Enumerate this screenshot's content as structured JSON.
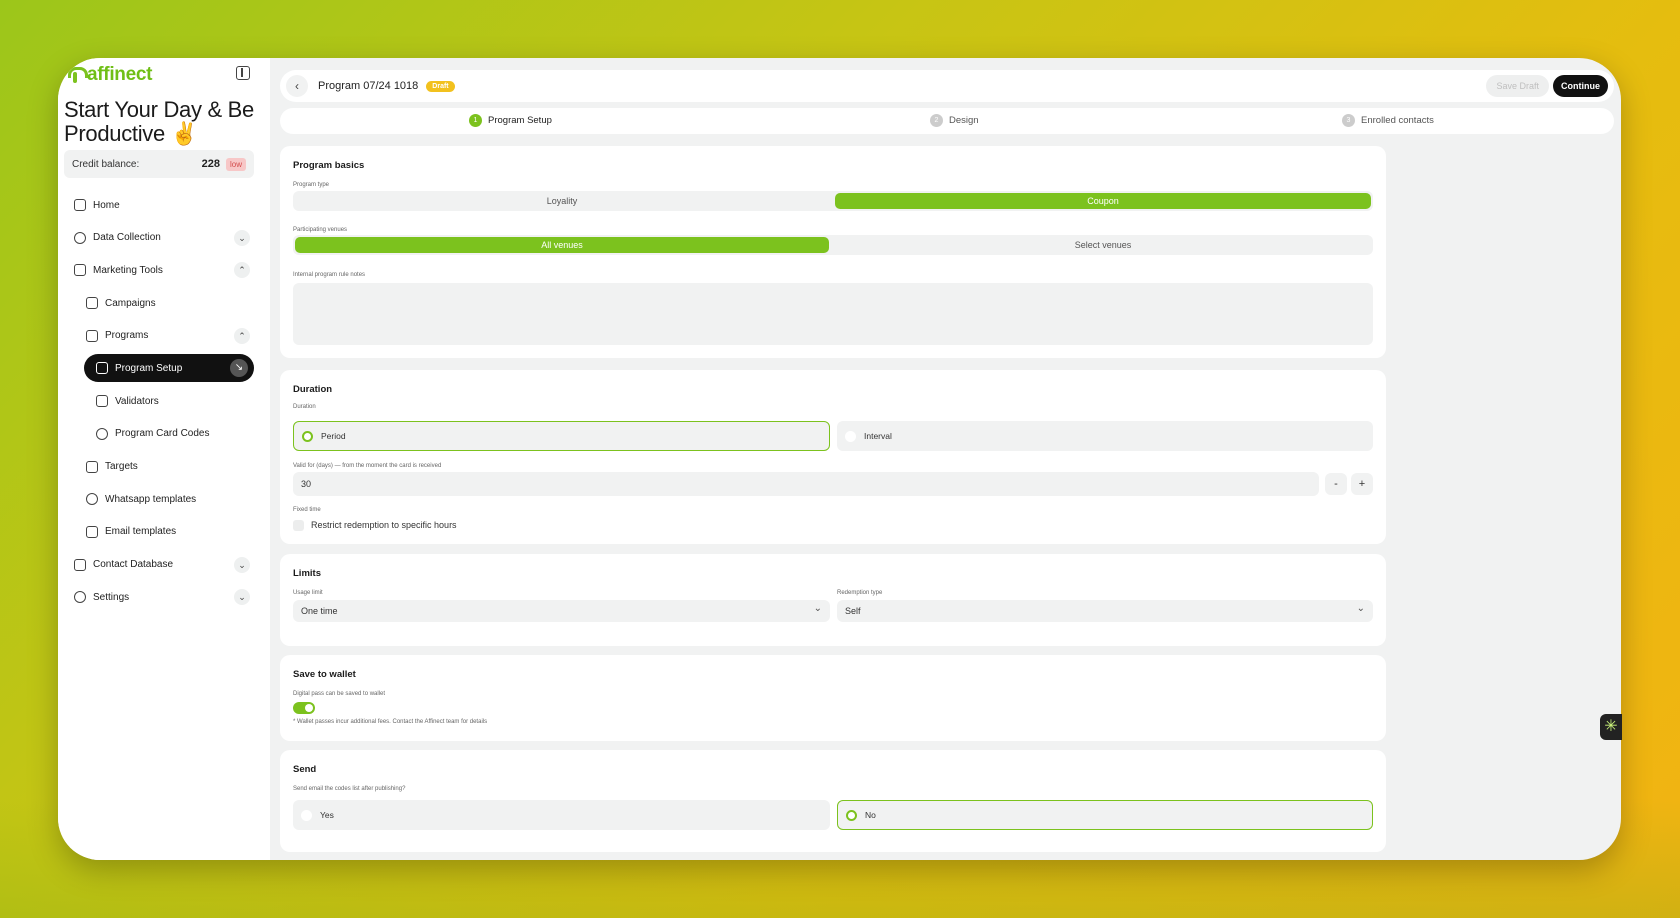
{
  "app": {
    "logo_text": "affinect"
  },
  "sidebar": {
    "greeting": "Start Your Day & Be Productive ✌️",
    "credit_label": "Credit balance:",
    "credit_value": "228",
    "credit_badge": "low",
    "items": [
      {
        "label": "Home"
      },
      {
        "label": "Data Collection"
      },
      {
        "label": "Marketing Tools"
      },
      {
        "label": "Campaigns"
      },
      {
        "label": "Programs"
      },
      {
        "label": "Program Setup"
      },
      {
        "label": "Validators"
      },
      {
        "label": "Program Card Codes"
      },
      {
        "label": "Targets"
      },
      {
        "label": "Whatsapp templates"
      },
      {
        "label": "Email templates"
      },
      {
        "label": "Contact Database"
      },
      {
        "label": "Settings"
      }
    ]
  },
  "header": {
    "back_icon": "‹",
    "title": "Program 07/24 1018",
    "status_badge": "Draft",
    "save_draft": "Save Draft",
    "continue": "Continue"
  },
  "steps": [
    {
      "num": "1",
      "label": "Program Setup"
    },
    {
      "num": "2",
      "label": "Design"
    },
    {
      "num": "3",
      "label": "Enrolled contacts"
    }
  ],
  "basics": {
    "title": "Program basics",
    "program_type_label": "Program type",
    "program_type_options": [
      "Loyality",
      "Coupon"
    ],
    "program_type_selected": "Coupon",
    "venues_label": "Participating venues",
    "venues_options": [
      "All venues",
      "Select venues"
    ],
    "venues_selected": "All venues",
    "notes_label": "Internal program rule notes",
    "notes_value": ""
  },
  "duration": {
    "title": "Duration",
    "label": "Duration",
    "options": [
      "Period",
      "Interval"
    ],
    "selected": "Period",
    "valid_label": "Valid for (days) — from the moment the card is received",
    "valid_value": "30",
    "minus": "-",
    "plus": "+",
    "fixed_label": "Fixed time",
    "restrict_label": "Restrict redemption to specific hours",
    "restrict_checked": false
  },
  "limits": {
    "title": "Limits",
    "usage_label": "Usage limit",
    "usage_value": "One time",
    "redemption_label": "Redemption type",
    "redemption_value": "Self"
  },
  "wallet": {
    "title": "Save to wallet",
    "label": "Digital pass can be saved to wallet",
    "enabled": true,
    "note": "* Wallet passes incur additional fees. Contact the Affinect team for details"
  },
  "send": {
    "title": "Send",
    "label": "Send email the codes list after publishing?",
    "options": [
      "Yes",
      "No"
    ],
    "selected": "No"
  },
  "float_icon": "✳"
}
